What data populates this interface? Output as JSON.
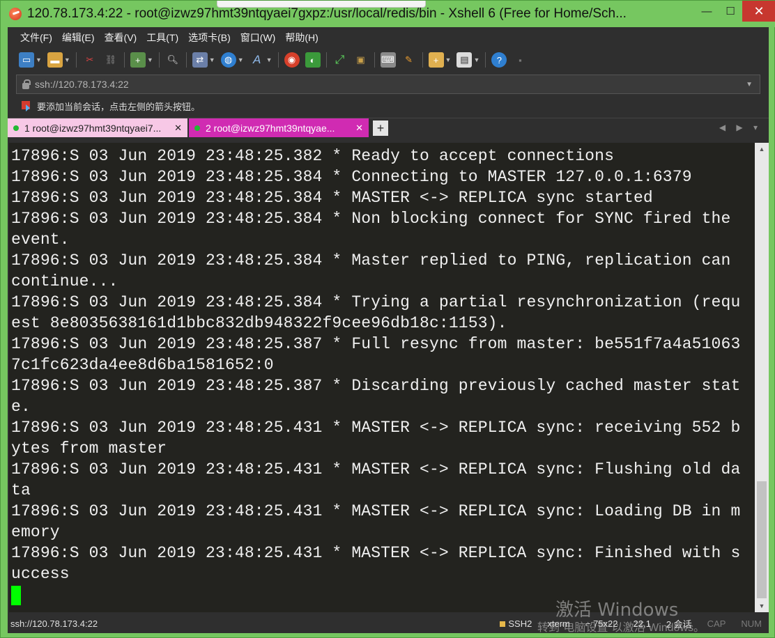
{
  "window": {
    "title": "120.78.173.4:22 - root@izwz97hmt39ntqyaei7gxpz:/usr/local/redis/bin - Xshell 6 (Free for Home/Sch...",
    "minimize_glyph": "—",
    "maximize_glyph": "☐",
    "close_glyph": "✕"
  },
  "menubar": {
    "items": [
      "文件(F)",
      "编辑(E)",
      "查看(V)",
      "工具(T)",
      "选项卡(B)",
      "窗口(W)",
      "帮助(H)"
    ]
  },
  "toolbar": {
    "icons": [
      "new-session-icon",
      "open-folder-icon",
      "disconnect-icon",
      "reconnect-icon",
      "new-window-icon",
      "find-icon",
      "transfer-icon",
      "globe-icon",
      "font-icon",
      "xshell-logo-icon",
      "xftp-icon",
      "fullscreen-icon",
      "lock-icon",
      "keyboard-icon",
      "highlight-icon",
      "script-icon",
      "layout-icon",
      "help-icon",
      "chat-icon"
    ]
  },
  "address": {
    "value": "ssh://120.78.173.4:22"
  },
  "hint": {
    "text": "要添加当前会话，点击左侧的箭头按钮。"
  },
  "tabs": [
    {
      "label": "1 root@izwz97hmt39ntqyaei7...",
      "close": "✕"
    },
    {
      "label": "2 root@izwz97hmt39ntqyae...",
      "close": "✕"
    }
  ],
  "tab_add_glyph": "+",
  "tab_nav": "◀ ▶ ▾",
  "terminal": {
    "lines": [
      "17896:S 03 Jun 2019 23:48:25.382 * Ready to accept connections",
      "17896:S 03 Jun 2019 23:48:25.384 * Connecting to MASTER 127.0.0.1:6379",
      "17896:S 03 Jun 2019 23:48:25.384 * MASTER <-> REPLICA sync started",
      "17896:S 03 Jun 2019 23:48:25.384 * Non blocking connect for SYNC fired the",
      "event.",
      "17896:S 03 Jun 2019 23:48:25.384 * Master replied to PING, replication can",
      "continue...",
      "17896:S 03 Jun 2019 23:48:25.384 * Trying a partial resynchronization (requ",
      "est 8e8035638161d1bbc832db948322f9cee96db18c:1153).",
      "17896:S 03 Jun 2019 23:48:25.387 * Full resync from master: be551f7a4a51063",
      "7c1fc623da4ee8d6ba1581652:0",
      "17896:S 03 Jun 2019 23:48:25.387 * Discarding previously cached master stat",
      "e.",
      "17896:S 03 Jun 2019 23:48:25.431 * MASTER <-> REPLICA sync: receiving 552 b",
      "ytes from master",
      "17896:S 03 Jun 2019 23:48:25.431 * MASTER <-> REPLICA sync: Flushing old da",
      "ta",
      "17896:S 03 Jun 2019 23:48:25.431 * MASTER <-> REPLICA sync: Loading DB in m",
      "emory",
      "17896:S 03 Jun 2019 23:48:25.431 * MASTER <-> REPLICA sync: Finished with s",
      "uccess"
    ]
  },
  "watermark": {
    "line1": "激活 Windows",
    "line2": "转到“电脑设置”以激活 Windows。"
  },
  "statusbar": {
    "connection": "ssh://120.78.173.4:22",
    "protocol": "SSH2",
    "terminal_type": "xterm",
    "size": "75x22",
    "cursor_pos": "22,1",
    "sessions": "2 会话",
    "caps": "CAP",
    "num": "NUM"
  },
  "colors": {
    "frame": "#76c760",
    "terminal_bg": "#23231f",
    "cursor": "#00ff00",
    "active_tab": "#d02bb2",
    "inactive_tab": "#f7c8e6"
  }
}
